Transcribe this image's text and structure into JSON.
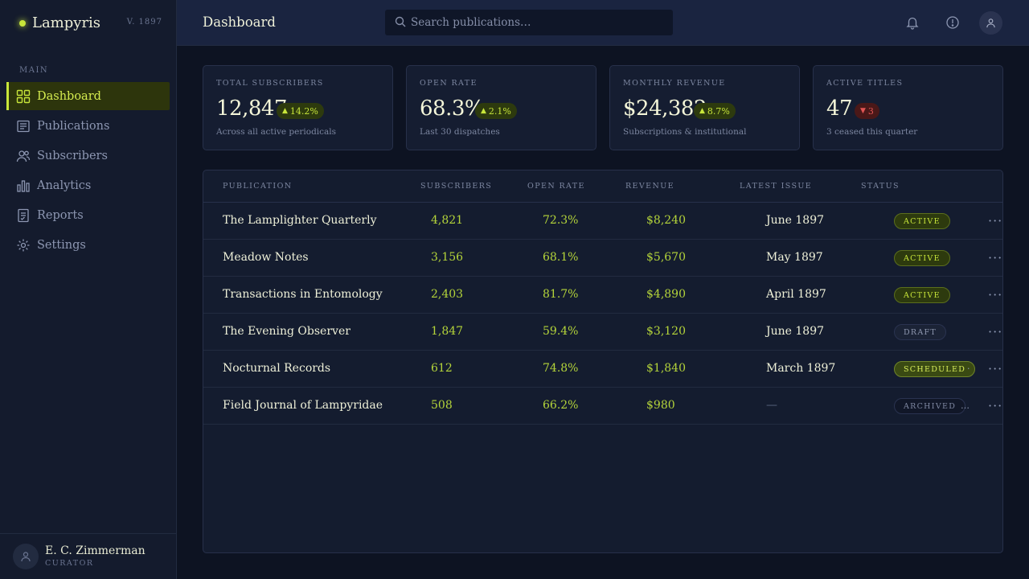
{
  "sidebar": {
    "brand": "Lampyris",
    "version": "V. 1897",
    "section": "MAIN",
    "items": [
      {
        "label": "Dashboard",
        "icon": "grid-icon",
        "active": true
      },
      {
        "label": "Publications",
        "icon": "newspaper-icon"
      },
      {
        "label": "Subscribers",
        "icon": "users-icon"
      },
      {
        "label": "Analytics",
        "icon": "bar-chart-icon"
      },
      {
        "label": "Reports",
        "icon": "report-icon"
      },
      {
        "label": "Settings",
        "icon": "gear-icon"
      }
    ],
    "user": {
      "name": "E. C. Zimmerman",
      "role": "CURATOR"
    }
  },
  "header": {
    "title": "Dashboard",
    "search_placeholder": "Search publications…",
    "icons": [
      "bell-icon",
      "alert-icon",
      "user-icon"
    ]
  },
  "stats": [
    {
      "label": "TOTAL SUBSCRIBERS",
      "value": "12,847",
      "delta": "14.2%",
      "direction": "up",
      "sub": "Across all active periodicals"
    },
    {
      "label": "OPEN RATE",
      "value": "68.3%",
      "delta": "2.1%",
      "direction": "up",
      "sub": "Last 30 dispatches"
    },
    {
      "label": "MONTHLY REVENUE",
      "value": "$24,382",
      "delta": "8.7%",
      "direction": "up",
      "sub": "Subscriptions & institutional"
    },
    {
      "label": "ACTIVE TITLES",
      "value": "47",
      "delta": "3",
      "direction": "down",
      "sub": "3 ceased this quarter"
    }
  ],
  "table": {
    "columns": [
      "PUBLICATION",
      "SUBSCRIBERS",
      "OPEN RATE",
      "REVENUE",
      "LATEST ISSUE",
      "STATUS"
    ],
    "rows": [
      {
        "name": "The Lamplighter Quarterly",
        "subscribers": "4,821",
        "open_rate": "72.3%",
        "revenue": "$8,240",
        "latest": "June 1897",
        "status": "ACTIVE"
      },
      {
        "name": "Meadow Notes",
        "subscribers": "3,156",
        "open_rate": "68.1%",
        "revenue": "$5,670",
        "latest": "May 1897",
        "status": "ACTIVE"
      },
      {
        "name": "Transactions in Entomology",
        "subscribers": "2,403",
        "open_rate": "81.7%",
        "revenue": "$4,890",
        "latest": "April 1897",
        "status": "ACTIVE"
      },
      {
        "name": "The Evening Observer",
        "subscribers": "1,847",
        "open_rate": "59.4%",
        "revenue": "$3,120",
        "latest": "June 1897",
        "status": "DRAFT"
      },
      {
        "name": "Nocturnal Records",
        "subscribers": "612",
        "open_rate": "74.8%",
        "revenue": "$1,840",
        "latest": "March 1897",
        "status": "SCHEDULED"
      },
      {
        "name": "Field Journal of Lampyridae",
        "subscribers": "508",
        "open_rate": "66.2%",
        "revenue": "$980",
        "latest": "—",
        "status": "ARCHIVED"
      }
    ],
    "row_menu": "···"
  },
  "colors": {
    "accent": "#c8e63a",
    "background": "#0d1322",
    "panel": "#141c2f",
    "danger": "#e25555"
  }
}
